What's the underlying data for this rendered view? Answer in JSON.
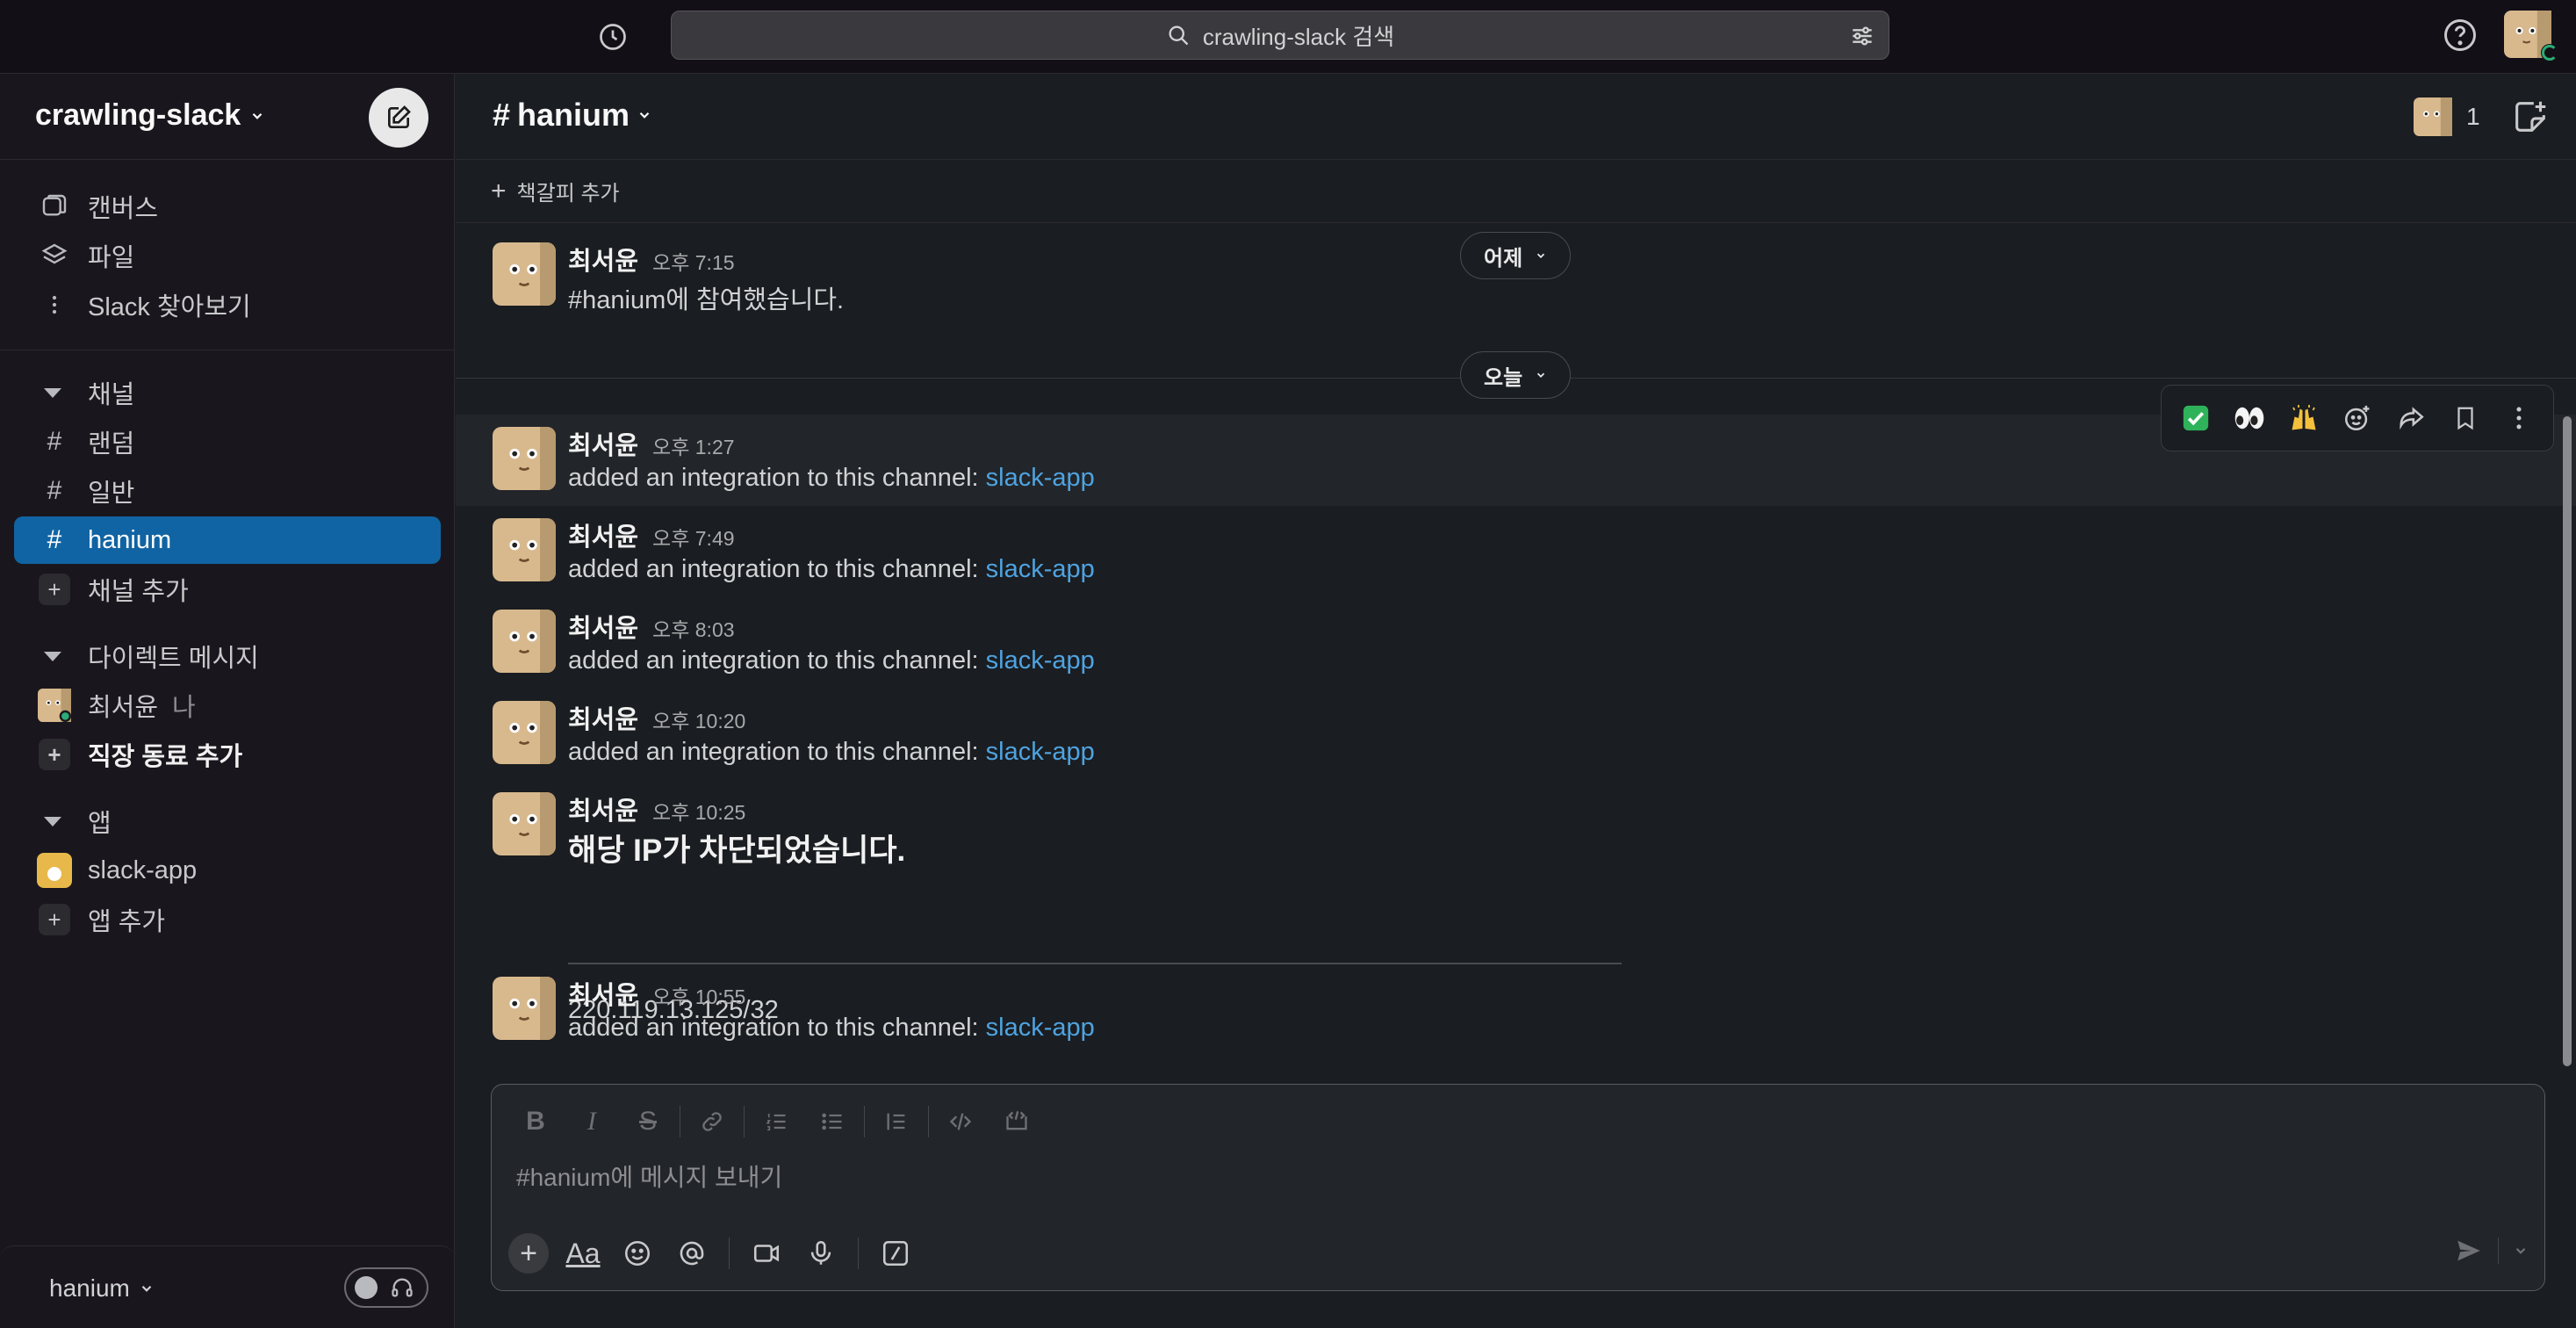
{
  "search": {
    "placeholder": "crawling-slack 검색"
  },
  "workspace": {
    "name": "crawling-slack"
  },
  "sidebar": {
    "top_items": [
      {
        "label": "캔버스",
        "icon": "canvas-icon"
      },
      {
        "label": "파일",
        "icon": "layers-icon"
      },
      {
        "label": "Slack 찾아보기",
        "icon": "more-vertical-icon"
      }
    ],
    "channels_title": "채널",
    "channels": [
      {
        "label": "랜덤",
        "active": false
      },
      {
        "label": "일반",
        "active": false
      },
      {
        "label": "hanium",
        "active": true
      }
    ],
    "add_channel": "채널 추가",
    "dm_title": "다이렉트 메시지",
    "dm_user": "최서윤",
    "dm_me": "나",
    "add_coworker": "직장 동료 추가",
    "apps_title": "앱",
    "app_item": "slack-app",
    "add_app": "앱 추가",
    "footer_ws": "hanium"
  },
  "channel": {
    "name": "hanium",
    "member_count": "1",
    "add_bookmark": "책갈피 추가"
  },
  "date_pills": {
    "yesterday": "어제",
    "today": "오늘"
  },
  "messages": [
    {
      "author": "최서윤",
      "time": "오후 7:15",
      "text": "#hanium에 참여했습니다."
    },
    {
      "author": "최서윤",
      "time": "오후 1:27",
      "text": "added an integration to this channel: ",
      "link": "slack-app"
    },
    {
      "author": "최서윤",
      "time": "오후 7:49",
      "text": "added an integration to this channel: ",
      "link": "slack-app"
    },
    {
      "author": "최서윤",
      "time": "오후 8:03",
      "text": "added an integration to this channel: ",
      "link": "slack-app"
    },
    {
      "author": "최서윤",
      "time": "오후 10:20",
      "text": "added an integration to this channel: ",
      "link": "slack-app"
    },
    {
      "author": "최서윤",
      "time": "오후 10:25",
      "heading": "해당 IP가 차단되었습니다.",
      "body": "220.119.13.125/32"
    },
    {
      "author": "최서윤",
      "time": "오후 10:55",
      "text": "added an integration to this channel: ",
      "link": "slack-app"
    }
  ],
  "hover_actions": [
    "check-mark-emoji",
    "eyes-emoji",
    "raised-hands-emoji",
    "add-reaction-icon",
    "share-icon",
    "bookmark-icon",
    "more-vertical-icon"
  ],
  "composer": {
    "placeholder": "#hanium에 메시지 보내기"
  },
  "colors": {
    "accent": "#1164a3",
    "link": "#4fa3e0",
    "background": "#1a1d21",
    "sidebar": "#19171d",
    "online": "#2bac76"
  }
}
